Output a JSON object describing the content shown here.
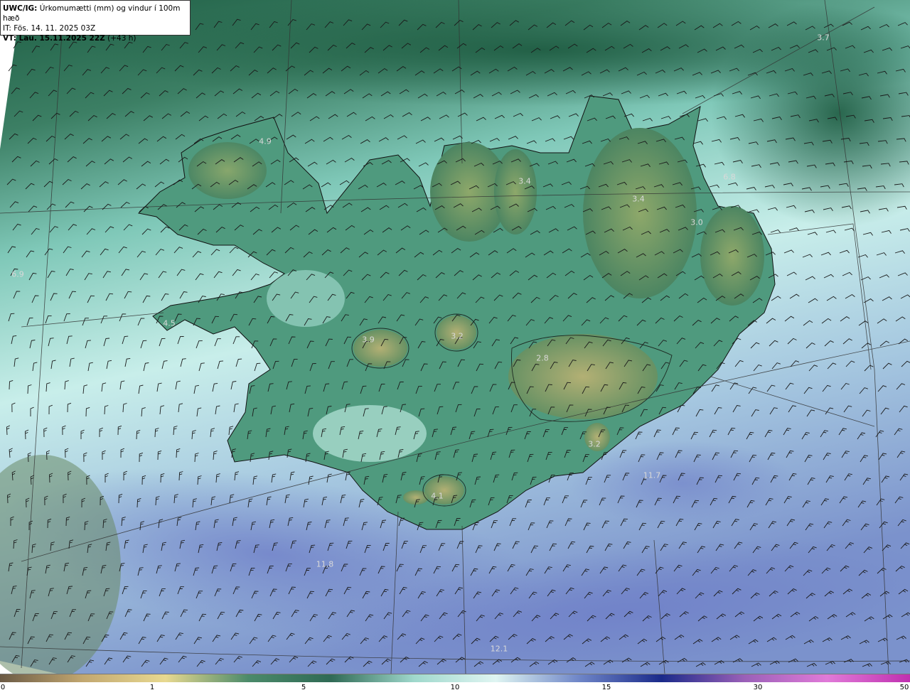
{
  "header": {
    "product": "UWC/IG:",
    "description": "Úrkomumætti (mm) og vindur í 100m hæð",
    "it_line": "IT: Fös. 14. 11. 2025 03Z",
    "vt_prefix": "VT: Lau. 15.11.2025 22Z",
    "vt_suffix": "(+43 h)"
  },
  "colorbar": {
    "ticks": [
      {
        "label": "0",
        "value": 0
      },
      {
        "label": "1",
        "value": 1
      },
      {
        "label": "5",
        "value": 5
      },
      {
        "label": "10",
        "value": 10
      },
      {
        "label": "15",
        "value": 15
      },
      {
        "label": "30",
        "value": 30
      },
      {
        "label": "50",
        "value": 50
      }
    ],
    "colors": [
      "#6b5a45",
      "#c2a770",
      "#e8d990",
      "#4b8a6a",
      "#2f6a55",
      "#9fd8cc",
      "#dff5f2",
      "#6f86c8",
      "#1a2a8a",
      "#9a60b8",
      "#e07ad8",
      "#c030b0"
    ]
  },
  "map_values": [
    {
      "label": "3.7"
    },
    {
      "label": "4.9"
    },
    {
      "label": "6.8"
    },
    {
      "label": "3.4"
    },
    {
      "label": "3.4"
    },
    {
      "label": "3.0"
    },
    {
      "label": "6.9"
    },
    {
      "label": "4.5"
    },
    {
      "label": "3.9"
    },
    {
      "label": "3.2"
    },
    {
      "label": "2.8"
    },
    {
      "label": "3.2"
    },
    {
      "label": "11.7"
    },
    {
      "label": "4.1"
    },
    {
      "label": "11.8"
    },
    {
      "label": "12.1"
    }
  ]
}
